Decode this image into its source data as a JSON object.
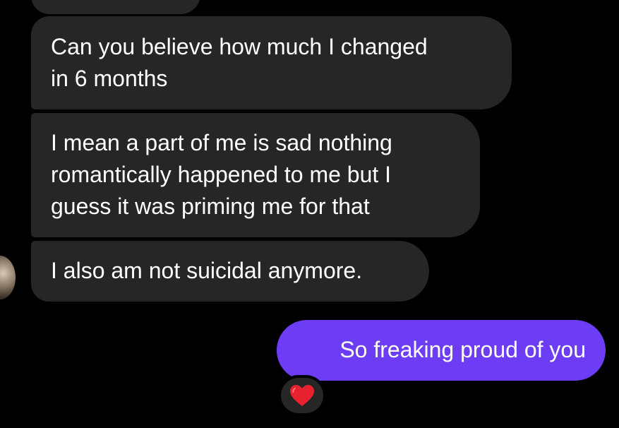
{
  "conversation": {
    "received": [
      {
        "text": "Can you believe how much I changed\nin 6 months"
      },
      {
        "text": "I mean a part of me is sad nothing\nromantically happened to me but I\nguess it was priming me for that"
      },
      {
        "text": "I also am not suicidal anymore."
      }
    ],
    "sent": [
      {
        "text": "So freaking proud of you",
        "reaction": "red-heart"
      }
    ]
  },
  "colors": {
    "background": "#000000",
    "received_bubble": "#262626",
    "sent_bubble": "#6d3df6",
    "text": "#ffffff",
    "heart": "#e8212f"
  }
}
